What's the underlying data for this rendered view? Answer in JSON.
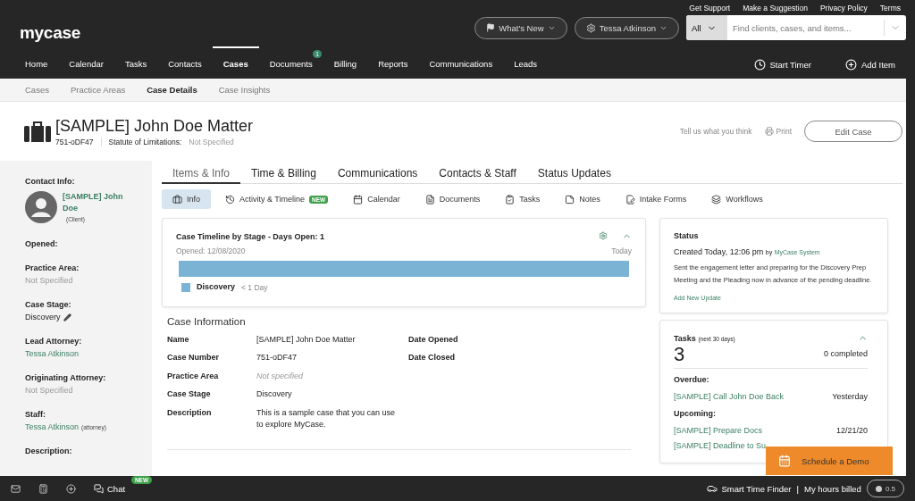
{
  "brand": {
    "logo": "mycase"
  },
  "utility_links": [
    "Get Support",
    "Make a Suggestion",
    "Privacy Policy",
    "Terms"
  ],
  "whats_new": {
    "label": "What's New"
  },
  "user_menu": {
    "label": "Tessa Atkinson"
  },
  "search": {
    "scope": "All",
    "placeholder": "Find clients, cases, and items..."
  },
  "main_nav": [
    {
      "label": "Home",
      "selected": false
    },
    {
      "label": "Calendar",
      "selected": false
    },
    {
      "label": "Tasks",
      "selected": false
    },
    {
      "label": "Contacts",
      "selected": false
    },
    {
      "label": "Cases",
      "selected": true
    },
    {
      "label": "Documents",
      "selected": false,
      "badge": "1"
    },
    {
      "label": "Billing",
      "selected": false
    },
    {
      "label": "Reports",
      "selected": false
    },
    {
      "label": "Communications",
      "selected": false
    },
    {
      "label": "Leads",
      "selected": false
    }
  ],
  "nav_actions": [
    {
      "kind": "timer",
      "label": "Start Timer"
    },
    {
      "kind": "add",
      "label": "Add Item"
    }
  ],
  "sub_nav": [
    {
      "label": "Cases",
      "selected": false
    },
    {
      "label": "Practice Areas",
      "selected": false
    },
    {
      "label": "Case Details",
      "selected": true
    },
    {
      "label": "Case Insights",
      "selected": false
    }
  ],
  "case_header": {
    "title": "[SAMPLE] John Doe Matter",
    "number": "751-oDF47",
    "sol_label": "Statute of Limitations:",
    "sol_value": "Not Specified",
    "feedback": "Tell us what you think",
    "print": "Print",
    "edit": "Edit Case"
  },
  "sidebar": {
    "contact_label": "Contact Info:",
    "contact_name": "[SAMPLE] John Doe",
    "contact_role": "(Client)",
    "fields": [
      {
        "label": "Opened:"
      },
      {
        "label": "Practice Area:",
        "value": "Not Specified",
        "kind": "muted"
      },
      {
        "label": "Case Stage:",
        "value": "Discovery",
        "kind": "editable"
      },
      {
        "label": "Lead Attorney:",
        "value": "Tessa Atkinson",
        "kind": "link"
      },
      {
        "label": "Originating Attorney:",
        "value": "Not Specified",
        "kind": "muted"
      },
      {
        "label": "Staff:",
        "value": "Tessa Atkinson",
        "note": "(attorney)",
        "kind": "link"
      },
      {
        "label": "Description:"
      }
    ]
  },
  "tabs": [
    {
      "label": "Items & Info",
      "selected": true
    },
    {
      "label": "Time & Billing",
      "selected": false
    },
    {
      "label": "Communications",
      "selected": false
    },
    {
      "label": "Contacts & Staff",
      "selected": false
    },
    {
      "label": "Status Updates",
      "selected": false
    }
  ],
  "sub_tabs": [
    {
      "label": "Info",
      "selected": true
    },
    {
      "label": "Activity & Timeline",
      "selected": false,
      "badge": "NEW"
    },
    {
      "label": "Calendar",
      "selected": false
    },
    {
      "label": "Documents",
      "selected": false
    },
    {
      "label": "Tasks",
      "selected": false
    },
    {
      "label": "Notes",
      "selected": false
    },
    {
      "label": "Intake Forms",
      "selected": false
    },
    {
      "label": "Workflows",
      "selected": false
    }
  ],
  "timeline": {
    "title": "Case Timeline by Stage - Days Open: 1",
    "opened": "Opened: 12/08/2020",
    "today": "Today",
    "stages": [
      {
        "name": "Discovery",
        "duration": "< 1 Day",
        "color": "#7ab3d3"
      }
    ]
  },
  "case_information": {
    "title": "Case Information",
    "rows": [
      {
        "label": "Name",
        "value": "[SAMPLE] John Doe Matter",
        "kind": "plain"
      },
      {
        "label": "Case Number",
        "value": "751-oDF47",
        "kind": "plain"
      },
      {
        "label": "Practice Area",
        "value": "Not specified",
        "kind": "muted"
      },
      {
        "label": "Case Stage",
        "value": "Discovery",
        "kind": "plain"
      },
      {
        "label": "Description",
        "value": "This is a sample case that you can use to explore MyCase.",
        "kind": "plain"
      }
    ],
    "dates": [
      {
        "label": "Date Opened"
      },
      {
        "label": "Date Closed"
      }
    ]
  },
  "status": {
    "title": "Status",
    "created": "Created Today, 12:06 pm",
    "by": "by",
    "author": "MyCase System",
    "text": "Sent the engagement letter and preparing for the Discovery Prep Meeting and the Pleading now in advance of the pending deadline.",
    "action": "Add New Update"
  },
  "tasks": {
    "title": "Tasks",
    "range": "(next 30 days)",
    "count": "3",
    "completed": "0 completed",
    "groups": [
      {
        "label": "Overdue:",
        "items": [
          {
            "name": "[SAMPLE] Call John Doe Back",
            "due": "Yesterday"
          }
        ]
      },
      {
        "label": "Upcoming:",
        "items": [
          {
            "name": "[SAMPLE] Prepare Docs",
            "due": "12/21/20"
          },
          {
            "name": "[SAMPLE] Deadline to Su"
          }
        ]
      }
    ]
  },
  "demo_button": {
    "label": "Schedule a Demo"
  },
  "bottom_bar": {
    "chat": "Chat",
    "chat_badge": "NEW",
    "time_finder": "Smart Time Finder",
    "separator": "|",
    "hours_label": "My hours billed",
    "hours": "0.5"
  }
}
